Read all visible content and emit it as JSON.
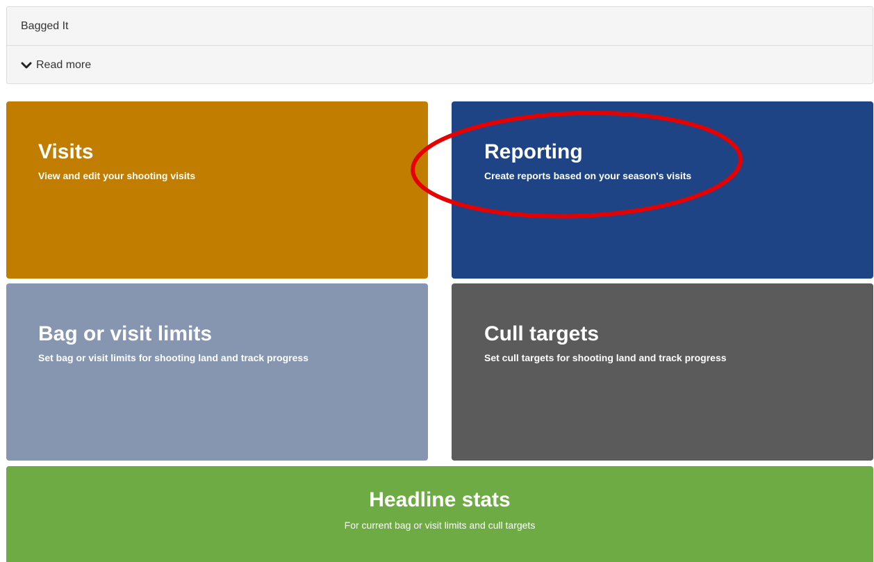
{
  "panel": {
    "title": "Bagged It",
    "read_more_label": "Read more",
    "read_more_icon": "chevron-down-icon"
  },
  "tiles": {
    "visits": {
      "title": "Visits",
      "subtitle": "View and edit your shooting visits",
      "color": "#c17d00"
    },
    "reporting": {
      "title": "Reporting",
      "subtitle": "Create reports based on your season's visits",
      "color": "#1f4485"
    },
    "limits": {
      "title": "Bag or visit limits",
      "subtitle": "Set bag or visit limits for shooting land and track progress",
      "color": "#8696b0"
    },
    "cull": {
      "title": "Cull targets",
      "subtitle": "Set cull targets for shooting land and track progress",
      "color": "#5b5b5b"
    },
    "stats": {
      "title": "Headline stats",
      "subtitle": "For current bag or visit limits and cull targets",
      "color": "#6fab45"
    }
  },
  "annotation": {
    "shape": "ellipse",
    "color": "#e60000",
    "target": "Reporting"
  }
}
